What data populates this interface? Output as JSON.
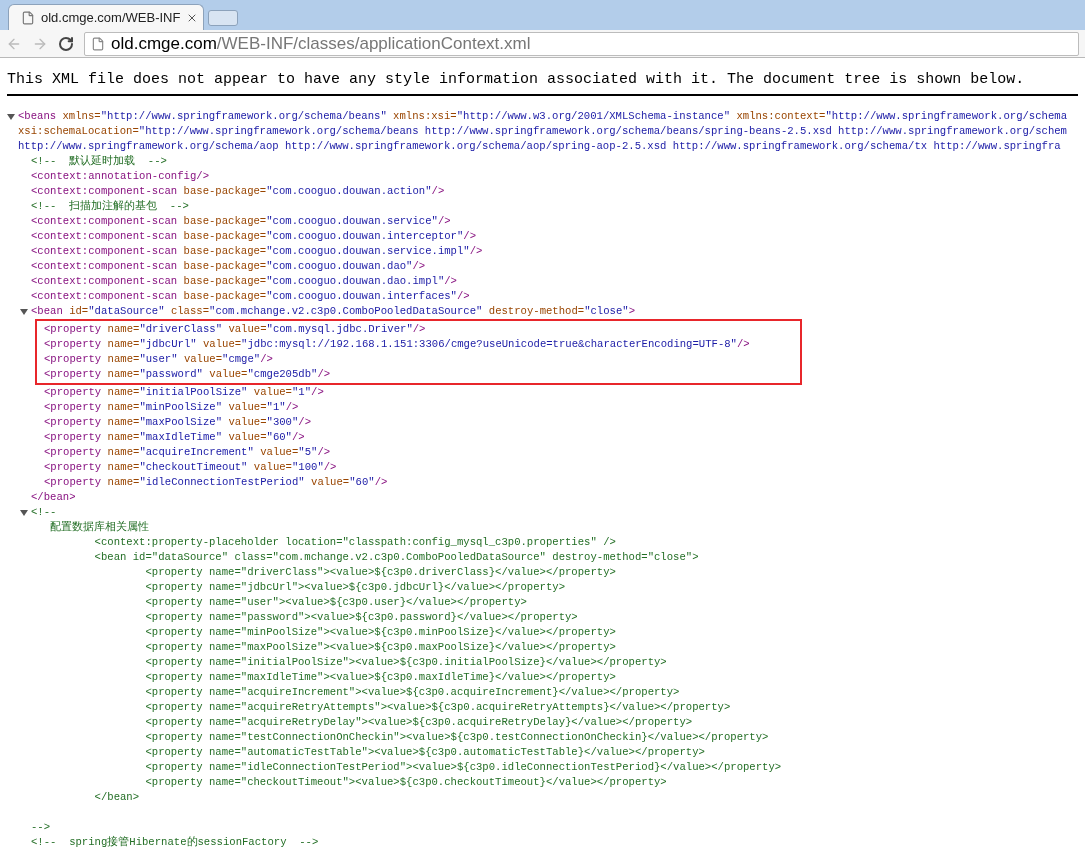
{
  "browser": {
    "tabs": [
      {
        "title": "old.cmge.com/WEB-INF",
        "selected": true
      }
    ],
    "address_bar": {
      "host": "old.cmge.com",
      "path": "/WEB-INF/classes/applicationContext.xml"
    }
  },
  "notice": "This XML file does not appear to have any style information associated with it. The document tree is shown below.",
  "tree": [
    {
      "kind": "element",
      "expanded": true,
      "open_lines": [
        [
          {
            "kind": "tag",
            "text": "<beans"
          },
          {
            "kind": "attr",
            "text": " xmlns="
          },
          {
            "kind": "value",
            "text": "\"http://www.springframework.org/schema/beans\""
          },
          {
            "kind": "attr",
            "text": " xmlns:xsi="
          },
          {
            "kind": "value",
            "text": "\"http://www.w3.org/2001/XMLSchema-instance\""
          },
          {
            "kind": "attr",
            "text": " xmlns:context="
          },
          {
            "kind": "value",
            "text": "\"http://www.springframework.org/schema"
          }
        ],
        [
          {
            "kind": "attr",
            "text": "xsi:schemaLocation="
          },
          {
            "kind": "value",
            "text": "\"http://www.springframework.org/schema/beans http://www.springframework.org/schema/beans/spring-beans-2.5.xsd http://www.springframework.org/schem"
          }
        ],
        [
          {
            "kind": "value",
            "text": "http://www.springframework.org/schema/aop http://www.springframework.org/schema/aop/spring-aop-2.5.xsd http://www.springframework.org/schema/tx http://www.springfra"
          }
        ]
      ],
      "children": [
        {
          "kind": "line",
          "tokens": [
            {
              "kind": "comment",
              "text": "<!--  默认延时加载  -->"
            }
          ]
        },
        {
          "kind": "line",
          "tokens": [
            {
              "kind": "tag",
              "text": "<context:annotation-config/>"
            }
          ]
        },
        {
          "kind": "line",
          "tokens": [
            {
              "kind": "tag",
              "text": "<context:component-scan"
            },
            {
              "kind": "attr",
              "text": " base-package="
            },
            {
              "kind": "value",
              "text": "\"com.cooguo.douwan.action\""
            },
            {
              "kind": "tag",
              "text": "/>"
            }
          ]
        },
        {
          "kind": "line",
          "tokens": [
            {
              "kind": "comment",
              "text": "<!--  扫描加注解的基包  -->"
            }
          ]
        },
        {
          "kind": "line",
          "tokens": [
            {
              "kind": "tag",
              "text": "<context:component-scan"
            },
            {
              "kind": "attr",
              "text": " base-package="
            },
            {
              "kind": "value",
              "text": "\"com.cooguo.douwan.service\""
            },
            {
              "kind": "tag",
              "text": "/>"
            }
          ]
        },
        {
          "kind": "line",
          "tokens": [
            {
              "kind": "tag",
              "text": "<context:component-scan"
            },
            {
              "kind": "attr",
              "text": " base-package="
            },
            {
              "kind": "value",
              "text": "\"com.cooguo.douwan.interceptor\""
            },
            {
              "kind": "tag",
              "text": "/>"
            }
          ]
        },
        {
          "kind": "line",
          "tokens": [
            {
              "kind": "tag",
              "text": "<context:component-scan"
            },
            {
              "kind": "attr",
              "text": " base-package="
            },
            {
              "kind": "value",
              "text": "\"com.cooguo.douwan.service.impl\""
            },
            {
              "kind": "tag",
              "text": "/>"
            }
          ]
        },
        {
          "kind": "line",
          "tokens": [
            {
              "kind": "tag",
              "text": "<context:component-scan"
            },
            {
              "kind": "attr",
              "text": " base-package="
            },
            {
              "kind": "value",
              "text": "\"com.cooguo.douwan.dao\""
            },
            {
              "kind": "tag",
              "text": "/>"
            }
          ]
        },
        {
          "kind": "line",
          "tokens": [
            {
              "kind": "tag",
              "text": "<context:component-scan"
            },
            {
              "kind": "attr",
              "text": " base-package="
            },
            {
              "kind": "value",
              "text": "\"com.cooguo.douwan.dao.impl\""
            },
            {
              "kind": "tag",
              "text": "/>"
            }
          ]
        },
        {
          "kind": "line",
          "tokens": [
            {
              "kind": "tag",
              "text": "<context:component-scan"
            },
            {
              "kind": "attr",
              "text": " base-package="
            },
            {
              "kind": "value",
              "text": "\"com.cooguo.douwan.interfaces\""
            },
            {
              "kind": "tag",
              "text": "/>"
            }
          ]
        },
        {
          "kind": "element",
          "expanded": true,
          "open_lines": [
            [
              {
                "kind": "tag",
                "text": "<bean"
              },
              {
                "kind": "attr",
                "text": " id="
              },
              {
                "kind": "value",
                "text": "\"dataSource\""
              },
              {
                "kind": "attr",
                "text": " class="
              },
              {
                "kind": "value",
                "text": "\"com.mchange.v2.c3p0.ComboPooledDataSource\""
              },
              {
                "kind": "attr",
                "text": " destroy-method="
              },
              {
                "kind": "value",
                "text": "\"close\""
              },
              {
                "kind": "tag",
                "text": ">"
              }
            ]
          ],
          "children": [
            {
              "kind": "highlight",
              "children": [
                {
                  "kind": "line",
                  "tokens": [
                    {
                      "kind": "tag",
                      "text": "<property"
                    },
                    {
                      "kind": "attr",
                      "text": " name="
                    },
                    {
                      "kind": "value",
                      "text": "\"driverClass\""
                    },
                    {
                      "kind": "attr",
                      "text": " value="
                    },
                    {
                      "kind": "value",
                      "text": "\"com.mysql.jdbc.Driver\""
                    },
                    {
                      "kind": "tag",
                      "text": "/>"
                    }
                  ]
                },
                {
                  "kind": "line",
                  "tokens": [
                    {
                      "kind": "tag",
                      "text": "<property"
                    },
                    {
                      "kind": "attr",
                      "text": " name="
                    },
                    {
                      "kind": "value",
                      "text": "\"jdbcUrl\""
                    },
                    {
                      "kind": "attr",
                      "text": " value="
                    },
                    {
                      "kind": "value",
                      "text": "\"jdbc:mysql://192.168.1.151:3306/cmge?useUnicode=true&characterEncoding=UTF-8\""
                    },
                    {
                      "kind": "tag",
                      "text": "/>"
                    }
                  ]
                },
                {
                  "kind": "line",
                  "tokens": [
                    {
                      "kind": "tag",
                      "text": "<property"
                    },
                    {
                      "kind": "attr",
                      "text": " name="
                    },
                    {
                      "kind": "value",
                      "text": "\"user\""
                    },
                    {
                      "kind": "attr",
                      "text": " value="
                    },
                    {
                      "kind": "value",
                      "text": "\"cmge\""
                    },
                    {
                      "kind": "tag",
                      "text": "/>"
                    }
                  ]
                },
                {
                  "kind": "line",
                  "tokens": [
                    {
                      "kind": "tag",
                      "text": "<property"
                    },
                    {
                      "kind": "attr",
                      "text": " name="
                    },
                    {
                      "kind": "value",
                      "text": "\"password\""
                    },
                    {
                      "kind": "attr",
                      "text": " value="
                    },
                    {
                      "kind": "value",
                      "text": "\"cmge205db\""
                    },
                    {
                      "kind": "tag",
                      "text": "/>"
                    }
                  ]
                }
              ]
            },
            {
              "kind": "line",
              "tokens": [
                {
                  "kind": "tag",
                  "text": "<property"
                },
                {
                  "kind": "attr",
                  "text": " name="
                },
                {
                  "kind": "value",
                  "text": "\"initialPoolSize\""
                },
                {
                  "kind": "attr",
                  "text": " value="
                },
                {
                  "kind": "value",
                  "text": "\"1\""
                },
                {
                  "kind": "tag",
                  "text": "/>"
                }
              ]
            },
            {
              "kind": "line",
              "tokens": [
                {
                  "kind": "tag",
                  "text": "<property"
                },
                {
                  "kind": "attr",
                  "text": " name="
                },
                {
                  "kind": "value",
                  "text": "\"minPoolSize\""
                },
                {
                  "kind": "attr",
                  "text": " value="
                },
                {
                  "kind": "value",
                  "text": "\"1\""
                },
                {
                  "kind": "tag",
                  "text": "/>"
                }
              ]
            },
            {
              "kind": "line",
              "tokens": [
                {
                  "kind": "tag",
                  "text": "<property"
                },
                {
                  "kind": "attr",
                  "text": " name="
                },
                {
                  "kind": "value",
                  "text": "\"maxPoolSize\""
                },
                {
                  "kind": "attr",
                  "text": " value="
                },
                {
                  "kind": "value",
                  "text": "\"300\""
                },
                {
                  "kind": "tag",
                  "text": "/>"
                }
              ]
            },
            {
              "kind": "line",
              "tokens": [
                {
                  "kind": "tag",
                  "text": "<property"
                },
                {
                  "kind": "attr",
                  "text": " name="
                },
                {
                  "kind": "value",
                  "text": "\"maxIdleTime\""
                },
                {
                  "kind": "attr",
                  "text": " value="
                },
                {
                  "kind": "value",
                  "text": "\"60\""
                },
                {
                  "kind": "tag",
                  "text": "/>"
                }
              ]
            },
            {
              "kind": "line",
              "tokens": [
                {
                  "kind": "tag",
                  "text": "<property"
                },
                {
                  "kind": "attr",
                  "text": " name="
                },
                {
                  "kind": "value",
                  "text": "\"acquireIncrement\""
                },
                {
                  "kind": "attr",
                  "text": " value="
                },
                {
                  "kind": "value",
                  "text": "\"5\""
                },
                {
                  "kind": "tag",
                  "text": "/>"
                }
              ]
            },
            {
              "kind": "line",
              "tokens": [
                {
                  "kind": "tag",
                  "text": "<property"
                },
                {
                  "kind": "attr",
                  "text": " name="
                },
                {
                  "kind": "value",
                  "text": "\"checkoutTimeout\""
                },
                {
                  "kind": "attr",
                  "text": " value="
                },
                {
                  "kind": "value",
                  "text": "\"100\""
                },
                {
                  "kind": "tag",
                  "text": "/>"
                }
              ]
            },
            {
              "kind": "line",
              "tokens": [
                {
                  "kind": "tag",
                  "text": "<property"
                },
                {
                  "kind": "attr",
                  "text": " name="
                },
                {
                  "kind": "value",
                  "text": "\"idleConnectionTestPeriod\""
                },
                {
                  "kind": "attr",
                  "text": " value="
                },
                {
                  "kind": "value",
                  "text": "\"60\""
                },
                {
                  "kind": "tag",
                  "text": "/>"
                }
              ]
            }
          ],
          "close": [
            {
              "kind": "tag",
              "text": "</bean>"
            }
          ]
        },
        {
          "kind": "comment",
          "expanded": true,
          "open": "<!--",
          "lines": [
            "   配置数据库相关属性",
            "          <context:property-placeholder location=\"classpath:config_mysql_c3p0.properties\" />",
            "          <bean id=\"dataSource\" class=\"com.mchange.v2.c3p0.ComboPooledDataSource\" destroy-method=\"close\">",
            "                  <property name=\"driverClass\"><value>${c3p0.driverClass}</value></property>",
            "                  <property name=\"jdbcUrl\"><value>${c3p0.jdbcUrl}</value></property>",
            "                  <property name=\"user\"><value>${c3p0.user}</value></property>",
            "                  <property name=\"password\"><value>${c3p0.password}</value></property>",
            "                  <property name=\"minPoolSize\"><value>${c3p0.minPoolSize}</value></property>",
            "                  <property name=\"maxPoolSize\"><value>${c3p0.maxPoolSize}</value></property>",
            "                  <property name=\"initialPoolSize\"><value>${c3p0.initialPoolSize}</value></property>",
            "                  <property name=\"maxIdleTime\"><value>${c3p0.maxIdleTime}</value></property>",
            "                  <property name=\"acquireIncrement\"><value>${c3p0.acquireIncrement}</value></property>",
            "                  <property name=\"acquireRetryAttempts\"><value>${c3p0.acquireRetryAttempts}</value></property>",
            "                  <property name=\"acquireRetryDelay\"><value>${c3p0.acquireRetryDelay}</value></property>",
            "                  <property name=\"testConnectionOnCheckin\"><value>${c3p0.testConnectionOnCheckin}</value></property>",
            "                  <property name=\"automaticTestTable\"><value>${c3p0.automaticTestTable}</value></property>",
            "                  <property name=\"idleConnectionTestPeriod\"><value>${c3p0.idleConnectionTestPeriod}</value></property>",
            "                  <property name=\"checkoutTimeout\"><value>${c3p0.checkoutTimeout}</value></property>",
            "          </bean>"
          ],
          "close": "-->"
        },
        {
          "kind": "line",
          "tokens": [
            {
              "kind": "comment",
              "text": "<!--  spring接管Hibernate的sessionFactory  -->"
            }
          ]
        }
      ]
    }
  ]
}
